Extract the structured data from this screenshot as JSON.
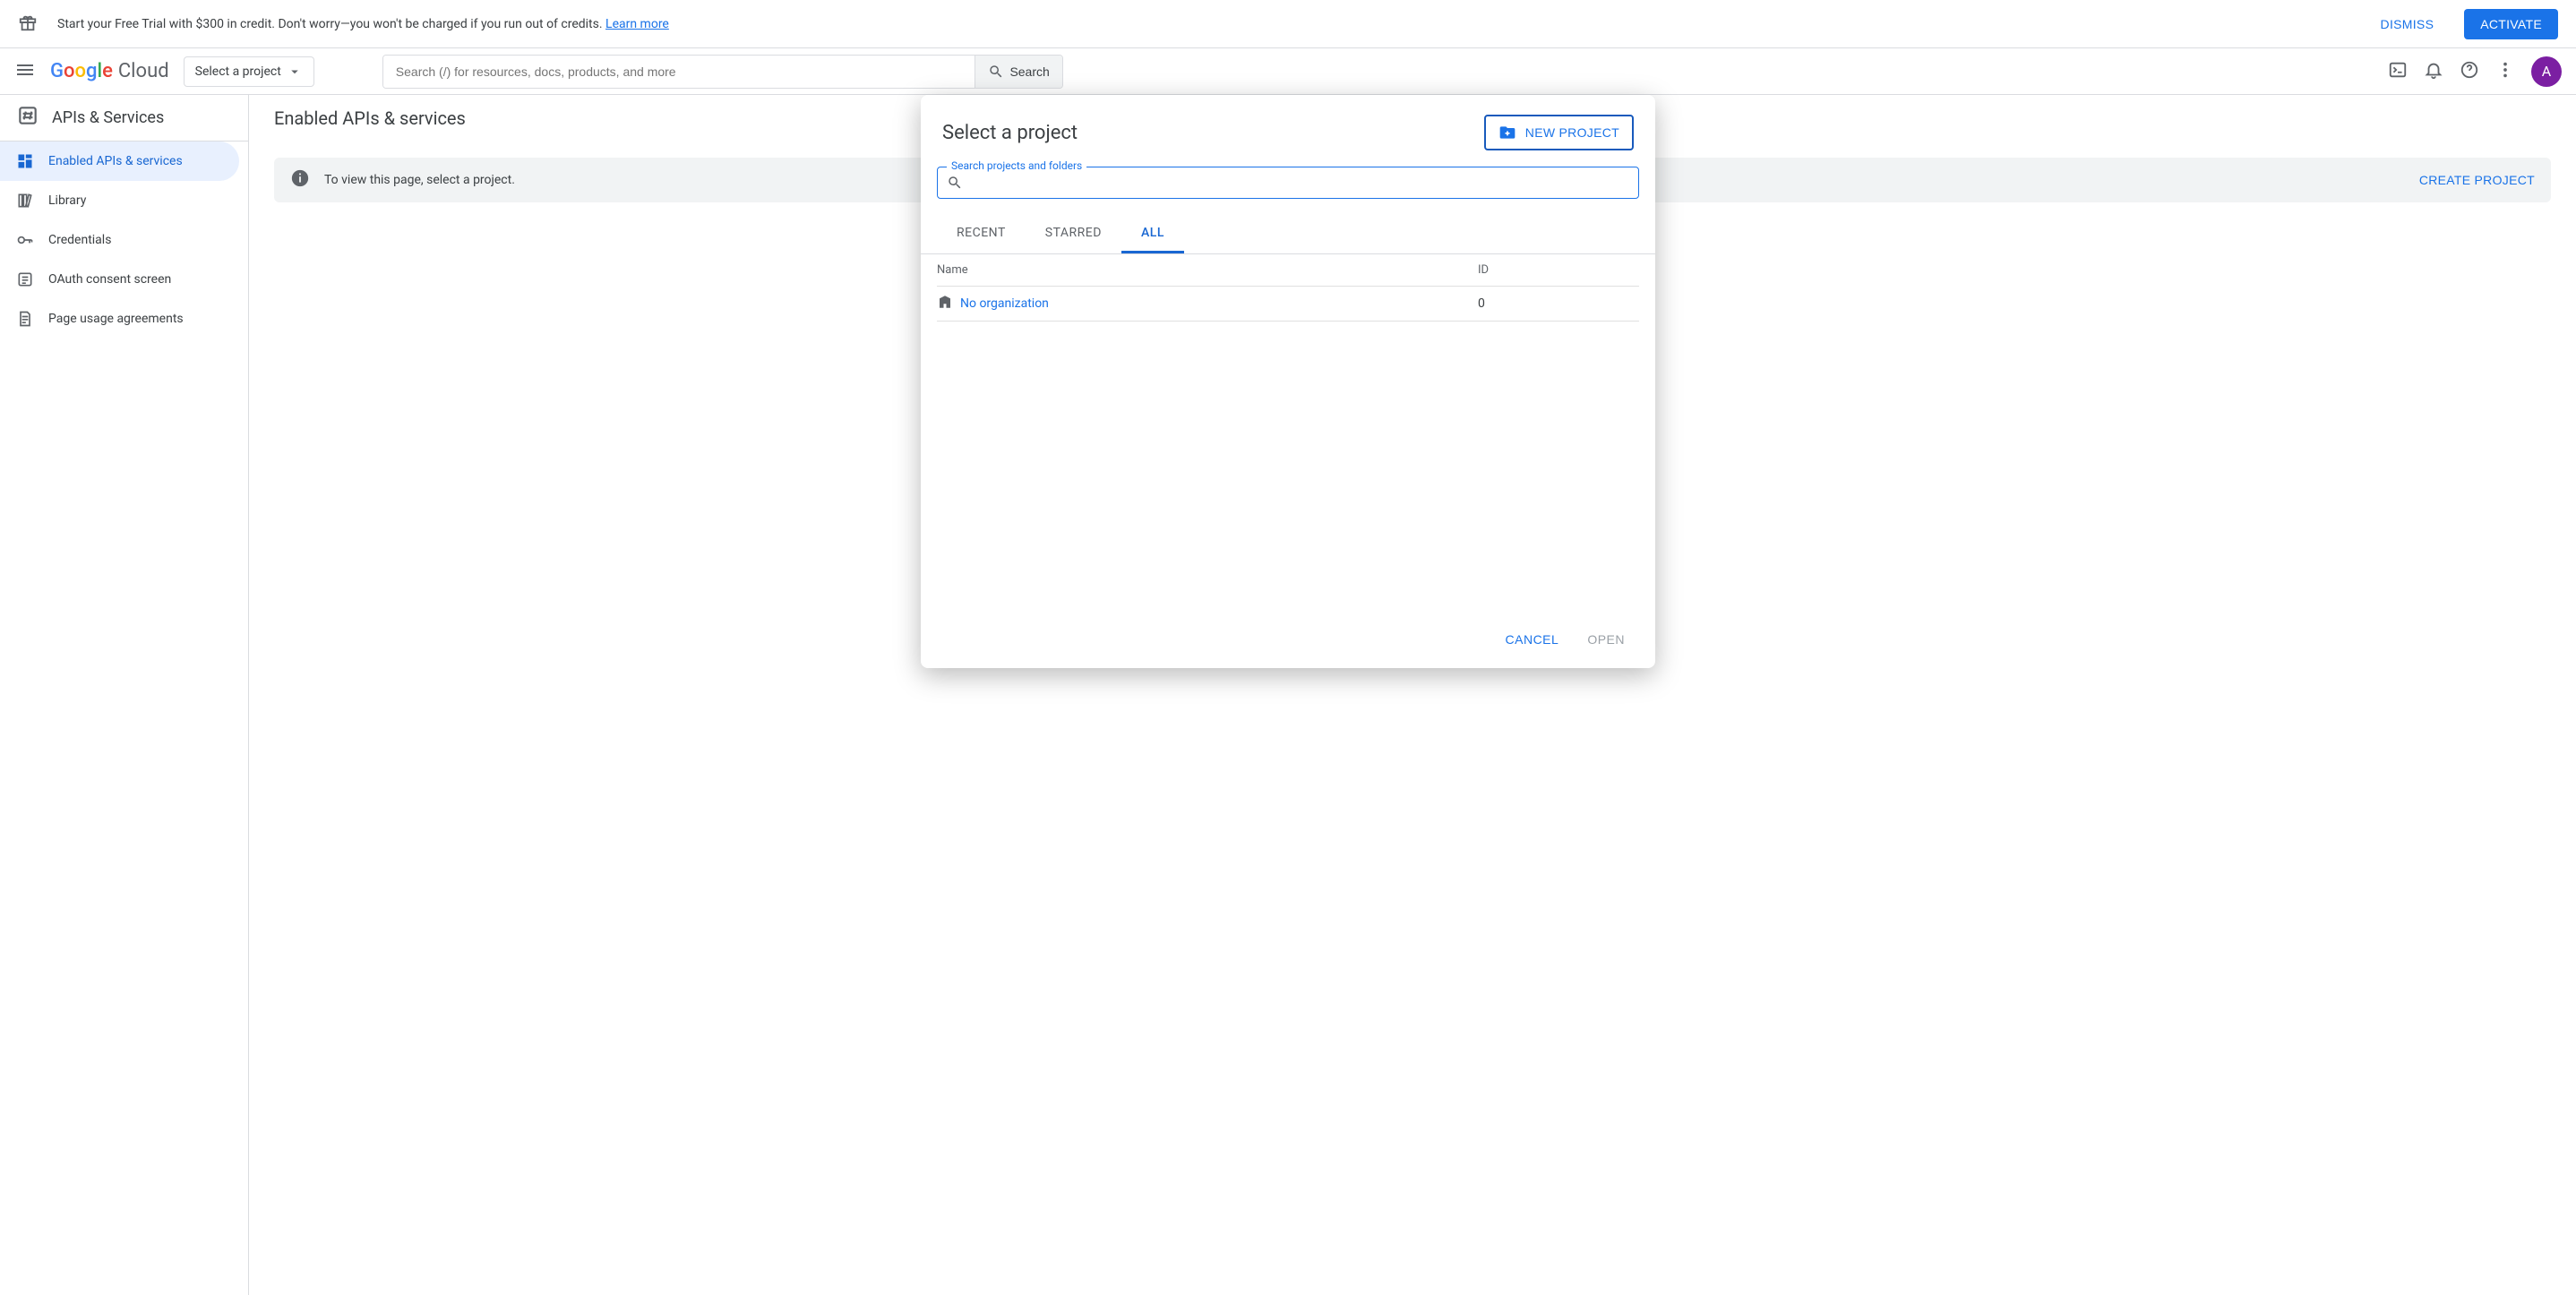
{
  "trial_banner": {
    "text_prefix": "Start your Free Trial with $300 in credit. Don't worry—you won't be charged if you run out of credits. ",
    "learn_more": "Learn more",
    "dismiss": "DISMISS",
    "activate": "ACTIVATE"
  },
  "header": {
    "logo_cloud": "Cloud",
    "project_chip": "Select a project",
    "search_placeholder": "Search (/) for resources, docs, products, and more",
    "search_btn": "Search",
    "avatar_initial": "A"
  },
  "sidebar": {
    "title": "APIs & Services",
    "items": [
      {
        "label": "Enabled APIs & services",
        "active": true
      },
      {
        "label": "Library",
        "active": false
      },
      {
        "label": "Credentials",
        "active": false
      },
      {
        "label": "OAuth consent screen",
        "active": false
      },
      {
        "label": "Page usage agreements",
        "active": false
      }
    ]
  },
  "main": {
    "title": "Enabled APIs & services",
    "info_banner": "To view this page, select a project.",
    "create_project": "CREATE PROJECT"
  },
  "modal": {
    "title": "Select a project",
    "new_project": "NEW PROJECT",
    "search_label": "Search projects and folders",
    "tabs": [
      "RECENT",
      "STARRED",
      "ALL"
    ],
    "active_tab": 2,
    "table": {
      "head_name": "Name",
      "head_id": "ID",
      "rows": [
        {
          "name": "No organization",
          "id": "0"
        }
      ]
    },
    "cancel": "CANCEL",
    "open": "OPEN"
  }
}
